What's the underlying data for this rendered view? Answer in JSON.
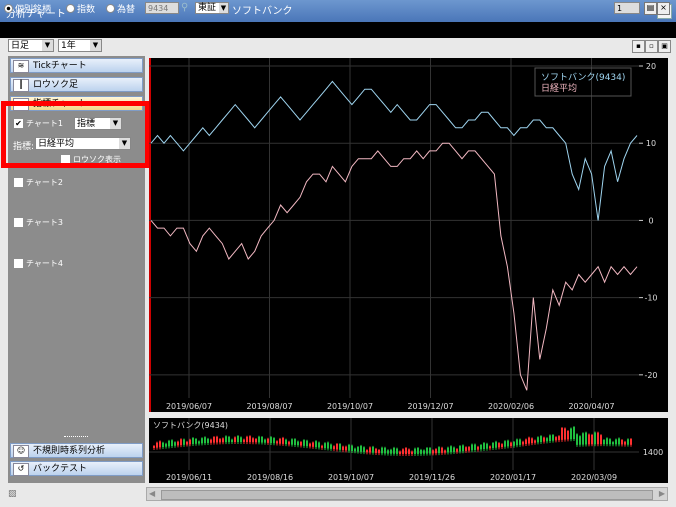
{
  "window": {
    "title": "分析チャート",
    "close_label": "×"
  },
  "toolbar": {
    "radios": [
      {
        "label": "個別銘柄",
        "selected": true
      },
      {
        "label": "指数",
        "selected": false
      },
      {
        "label": "為替",
        "selected": false
      }
    ],
    "code_value": "9434",
    "market_value": "東証",
    "stock_name": "ソフトバンク",
    "page_value": "1",
    "period_type": "日足",
    "period_range": "1年"
  },
  "sidebar": {
    "buttons_top": [
      {
        "label": "Tickチャート",
        "icon": "tick-chart-icon"
      },
      {
        "label": "ロウソク足",
        "icon": "candlestick-icon"
      },
      {
        "label": "指標チャート",
        "icon": "indicator-chart-icon"
      }
    ],
    "chart1": {
      "label": "チャート1",
      "checked": true,
      "type_value": "指標"
    },
    "indicator_label": "指標:",
    "indicator_value": "日経平均",
    "candle_label": "ロウソク表示",
    "chart2": {
      "label": "チャート2"
    },
    "chart3": {
      "label": "チャート3"
    },
    "chart4": {
      "label": "チャート4"
    },
    "buttons_bottom": [
      {
        "label": "不規則時系列分析",
        "icon": "analysis-icon"
      },
      {
        "label": "バックテスト",
        "icon": "backtest-icon"
      }
    ]
  },
  "chart_data": [
    {
      "type": "line",
      "legend": [
        "ソフトバンク(9434)",
        "日経平均"
      ],
      "x_ticks": [
        "2019/06/07",
        "2019/08/07",
        "2019/10/07",
        "2019/12/07",
        "2020/02/06",
        "2020/04/07"
      ],
      "y_ticks": [
        20,
        10,
        0,
        -10,
        -20
      ],
      "ylim": [
        -23,
        20
      ],
      "grid": true,
      "colors": {
        "softbank": "#9ed4ef",
        "nikkei": "#f2b8c2"
      },
      "series": [
        {
          "name": "ソフトバンク(9434)",
          "values": [
            10,
            11,
            10,
            11,
            10,
            9,
            10,
            11,
            12,
            11,
            12,
            13,
            14,
            15,
            14,
            13,
            12,
            13,
            14,
            15,
            16,
            15,
            14,
            13,
            14,
            15,
            16,
            17,
            18,
            17,
            16,
            15,
            16,
            17,
            17,
            16,
            15,
            14,
            15,
            14,
            13,
            13,
            14,
            15,
            15,
            14,
            13,
            12,
            12,
            13,
            13,
            14,
            14,
            13,
            12,
            12,
            11,
            12,
            12,
            13,
            13,
            12,
            12,
            11,
            10,
            6,
            4,
            8,
            6,
            0,
            7,
            9,
            5,
            8,
            10,
            11
          ]
        },
        {
          "name": "日経平均",
          "values": [
            0,
            -1,
            -1,
            -2,
            -1,
            -1,
            -3,
            -4,
            -2,
            -1,
            -2,
            -3,
            -5,
            -4,
            -3,
            -5,
            -4,
            -2,
            -1,
            0,
            2,
            1,
            2,
            3,
            5,
            6,
            6,
            5,
            7,
            6,
            5,
            7,
            8,
            8,
            8,
            9,
            8,
            7,
            7,
            8,
            8,
            9,
            8,
            9,
            9,
            10,
            10,
            9,
            8,
            9,
            9,
            8,
            7,
            6,
            -2,
            -6,
            -12,
            -20,
            -22,
            -10,
            -18,
            -14,
            -9,
            -11,
            -8,
            -9,
            -7,
            -8,
            -7,
            -6,
            -8,
            -6,
            -7,
            -6,
            -7,
            -6
          ]
        }
      ]
    },
    {
      "type": "candlestick",
      "legend": [
        "ソフトバンク(9434)"
      ],
      "x_ticks": [
        "2019/06/11",
        "2019/08/16",
        "2019/10/07",
        "2019/11/26",
        "2020/01/17",
        "2020/03/09"
      ],
      "y_ticks": [
        1400
      ],
      "grid": true,
      "colors": {
        "up": "#ff3030",
        "down": "#20c040"
      }
    }
  ]
}
